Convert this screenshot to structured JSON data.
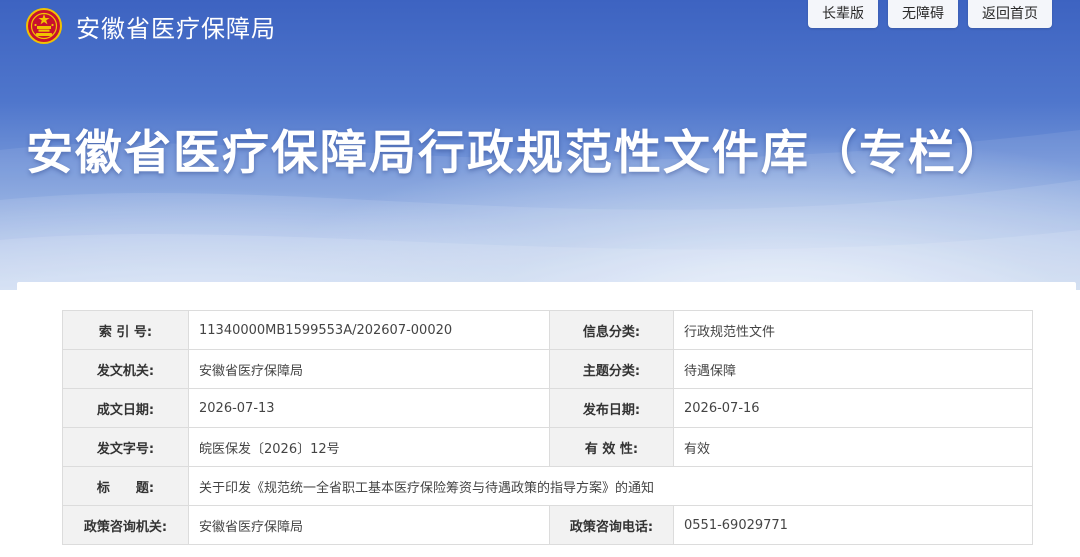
{
  "header": {
    "site_name": "安徽省医疗保障局",
    "emblem_icon": "national-emblem-icon",
    "buttons": [
      "长辈版",
      "无障碍",
      "返回首页"
    ],
    "hero_title": "安徽省医疗保障局行政规范性文件库（专栏）"
  },
  "colors": {
    "hero_blue": "#3d63c1",
    "label_bg": "#f2f2f2",
    "border": "#dcdcdc"
  },
  "meta": {
    "index_no_label": "索 引 号:",
    "index_no": "11340000MB1599553A/202607-00020",
    "info_category_label": "信息分类:",
    "info_category": "行政规范性文件",
    "issuer_label": "发文机关:",
    "issuer": "安徽省医疗保障局",
    "topic_label": "主题分类:",
    "topic": "待遇保障",
    "created_date_label": "成文日期:",
    "created_date": "2026-07-13",
    "publish_date_label": "发布日期:",
    "publish_date": "2026-07-16",
    "doc_no_label": "发文字号:",
    "doc_no": "皖医保发〔2026〕12号",
    "validity_label": "有 效 性:",
    "validity": "有效",
    "title_label": "标　　题:",
    "title": "关于印发《规范统一全省职工基本医疗保险筹资与待遇政策的指导方案》的通知",
    "consult_org_label": "政策咨询机关:",
    "consult_org": "安徽省医疗保障局",
    "consult_phone_label": "政策咨询电话:",
    "consult_phone": "0551-69029771"
  }
}
